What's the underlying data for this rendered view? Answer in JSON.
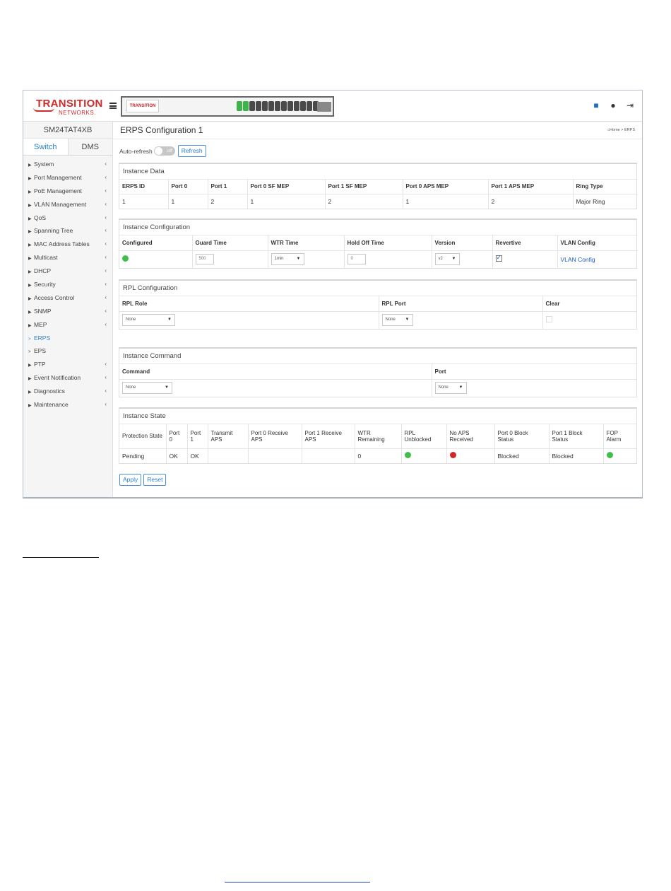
{
  "header": {
    "logo_line1": "TRANSITION",
    "logo_line2": "NETWORKS.",
    "panel_logo": "TRANSITION",
    "icons": [
      "save-icon",
      "help-icon",
      "logout-icon"
    ]
  },
  "sidebar": {
    "device_name": "SM24TAT4XB",
    "tabs": [
      "Switch",
      "DMS"
    ],
    "items": [
      {
        "label": "System",
        "type": "expand"
      },
      {
        "label": "Port Management",
        "type": "expand"
      },
      {
        "label": "PoE Management",
        "type": "expand"
      },
      {
        "label": "VLAN Management",
        "type": "expand"
      },
      {
        "label": "QoS",
        "type": "expand"
      },
      {
        "label": "Spanning Tree",
        "type": "expand"
      },
      {
        "label": "MAC Address Tables",
        "type": "expand"
      },
      {
        "label": "Multicast",
        "type": "expand"
      },
      {
        "label": "DHCP",
        "type": "expand"
      },
      {
        "label": "Security",
        "type": "expand"
      },
      {
        "label": "Access Control",
        "type": "expand"
      },
      {
        "label": "SNMP",
        "type": "expand"
      },
      {
        "label": "MEP",
        "type": "expand"
      },
      {
        "label": "ERPS",
        "type": "link"
      },
      {
        "label": "EPS",
        "type": "link"
      },
      {
        "label": "PTP",
        "type": "expand"
      },
      {
        "label": "Event Notification",
        "type": "expand"
      },
      {
        "label": "Diagnostics",
        "type": "expand"
      },
      {
        "label": "Maintenance",
        "type": "expand"
      }
    ]
  },
  "page": {
    "title": "ERPS Configuration 1",
    "breadcrumb_home": "Home",
    "breadcrumb_current": "ERPS",
    "auto_refresh_label": "Auto-refresh",
    "toggle_state": "off",
    "refresh_label": "Refresh",
    "apply_label": "Apply",
    "reset_label": "Reset"
  },
  "instance_data": {
    "title": "Instance Data",
    "headers": [
      "ERPS ID",
      "Port 0",
      "Port 1",
      "Port 0 SF MEP",
      "Port 1 SF MEP",
      "Port 0 APS MEP",
      "Port 1 APS MEP",
      "Ring Type"
    ],
    "row": [
      "1",
      "1",
      "2",
      "1",
      "2",
      "1",
      "2",
      "Major Ring"
    ]
  },
  "instance_config": {
    "title": "Instance Configuration",
    "headers": [
      "Configured",
      "Guard Time",
      "WTR Time",
      "Hold Off Time",
      "Version",
      "Revertive",
      "VLAN Config"
    ],
    "guard_time": "500",
    "wtr_time": "1min",
    "hold_off_time": "0",
    "version": "v2",
    "vlan_config_link": "VLAN Config"
  },
  "rpl_config": {
    "title": "RPL Configuration",
    "headers": [
      "RPL Role",
      "RPL Port",
      "Clear"
    ],
    "rpl_role": "None",
    "rpl_port": "None"
  },
  "instance_command": {
    "title": "Instance Command",
    "headers": [
      "Command",
      "Port"
    ],
    "command": "None",
    "port": "None"
  },
  "instance_state": {
    "title": "Instance State",
    "headers": [
      "Protection State",
      "Port 0",
      "Port 1",
      "Transmit APS",
      "Port 0 Receive APS",
      "Port 1 Receive APS",
      "WTR Remaining",
      "RPL Unblocked",
      "No APS Received",
      "Port 0 Block Status",
      "Port 1 Block Status",
      "FOP Alarm"
    ],
    "protection_state": "Pending",
    "port0": "OK",
    "port1": "OK",
    "transmit_aps": "",
    "port0_receive_aps": "",
    "port1_receive_aps": "",
    "wtr_remaining": "0",
    "port0_block_status": "Blocked",
    "port1_block_status": "Blocked"
  },
  "colors": {
    "accent": "#2a7fc9",
    "status_green": "#3fc04a",
    "status_red": "#d02828",
    "brand_red": "#d22a2a"
  }
}
